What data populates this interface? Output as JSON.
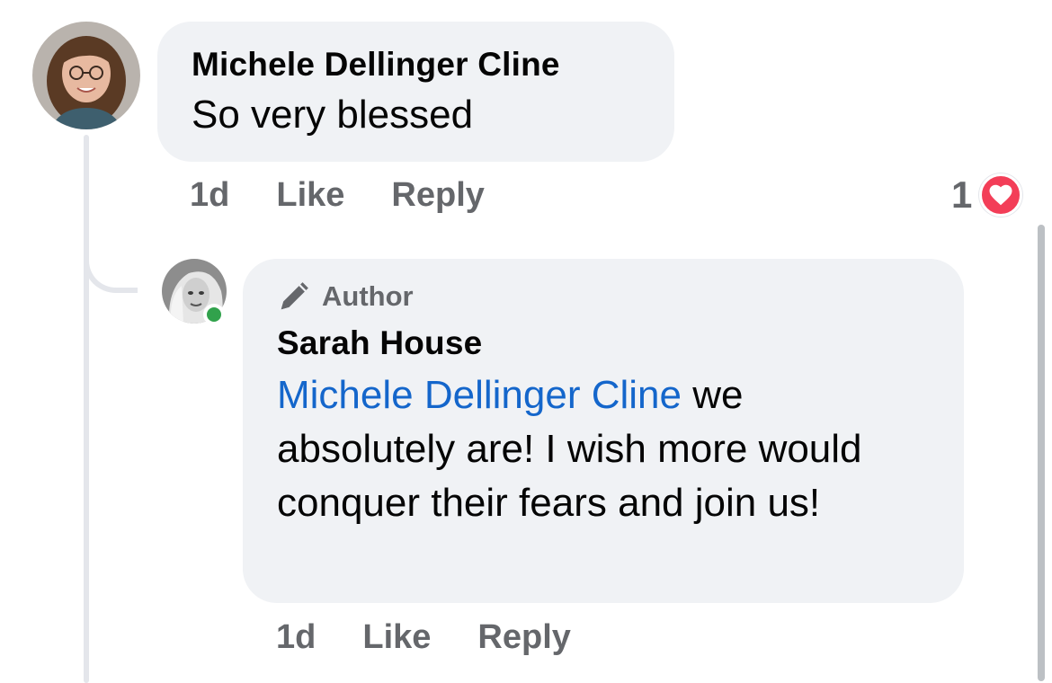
{
  "comment": {
    "author": "Michele Dellinger Cline",
    "text": "So very blessed",
    "time": "1d",
    "like_label": "Like",
    "reply_label": "Reply",
    "reaction_count": "1",
    "reaction_icon": "heart-icon",
    "reaction_color": "#f33e58"
  },
  "reply": {
    "badge_label": "Author",
    "badge_icon": "pen-icon",
    "author": "Sarah House",
    "mention": "Michele Dellinger Cline",
    "text": " we absolutely are! I wish more would conquer their fears and join us!",
    "time": "1d",
    "like_label": "Like",
    "reply_label": "Reply",
    "online_status_color": "#31a24c"
  },
  "colors": {
    "bubble_bg": "#f0f2f5",
    "mention": "#1466cb",
    "meta_text": "#65676b"
  }
}
